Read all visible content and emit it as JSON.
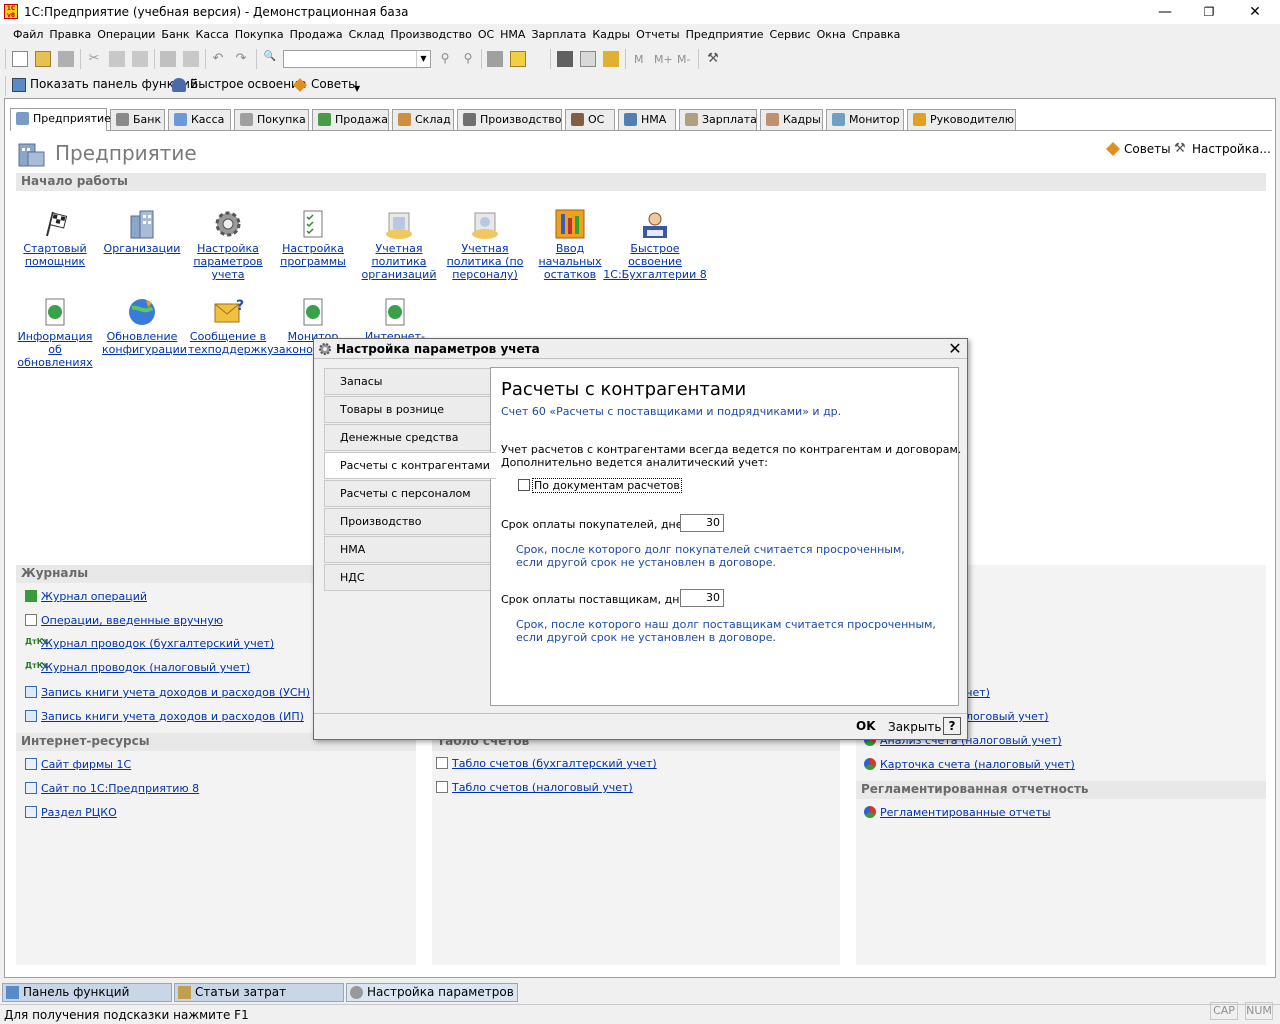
{
  "window": {
    "title": "1С:Предприятие (учебная версия) - Демонстрационная база",
    "app_icon_text": "1С v8"
  },
  "menu": [
    "Файл",
    "Правка",
    "Операции",
    "Банк",
    "Касса",
    "Покупка",
    "Продажа",
    "Склад",
    "Производство",
    "ОС",
    "НМА",
    "Зарплата",
    "Кадры",
    "Отчеты",
    "Предприятие",
    "Сервис",
    "Окна",
    "Справка"
  ],
  "toolbar2": {
    "show_panel": "Показать панель функций",
    "quick_learn": "Быстрое освоение",
    "tips": "Советы"
  },
  "toolbar_misc": {
    "m": "M",
    "mplus": "M+",
    "mminus": "M-"
  },
  "tabs": [
    "Предприятие",
    "Банк",
    "Касса",
    "Покупка",
    "Продажа",
    "Склад",
    "Производство",
    "ОС",
    "НМА",
    "Зарплата",
    "Кадры",
    "Монитор",
    "Руководителю"
  ],
  "page": {
    "title": "Предприятие",
    "tips_button": "Советы",
    "settings_button": "Настройка..."
  },
  "start_section": {
    "title": "Начало работы",
    "items_row1": [
      "Стартовый помощник",
      "Организации",
      "Настройка параметров учета",
      "Настройка программы",
      "Учетная политика организаций",
      "Учетная политика (по персоналу)",
      "Ввод начальных остатков",
      "Быстрое освоение 1С:Бухгалтерии 8"
    ],
    "items_row2": [
      "Информация об обновлениях",
      "Обновление конфигурации",
      "Сообщение в техподдержку",
      "Монитор законодательства",
      "Интернет-ресурс"
    ]
  },
  "journals": {
    "title": "Журналы",
    "links": [
      "Журнал операций",
      "Операции, введенные вручную",
      "Журнал проводок (бухгалтерский учет)",
      "Журнал проводок (налоговый учет)",
      "Запись книги учета доходов и расходов (УСН)",
      "Запись книги учета доходов и расходов (ИП)"
    ]
  },
  "internet": {
    "title": "Интернет-ресурсы",
    "links": [
      "Сайт фирмы 1С",
      "Сайт по 1С:Предприятию 8",
      "Раздел РЦКО"
    ]
  },
  "tablo": {
    "title": "Табло счетов",
    "links": [
      "Табло счетов (бухгалтерский учет)",
      "Табло счетов (налоговый учет)"
    ]
  },
  "right_col": {
    "partial1": "чет)",
    "partial2": "логовый учет)",
    "analysis": "Анализ счета (налоговый учет)",
    "card": "Карточка счета (налоговый учет)"
  },
  "reg": {
    "title": "Регламентированная отчетность",
    "links": [
      "Регламентированные отчеты"
    ]
  },
  "dialog": {
    "title": "Настройка параметров учета",
    "tabs": [
      "Запасы",
      "Товары в рознице",
      "Денежные средства",
      "Расчеты с контрагентами",
      "Расчеты с персоналом",
      "Производство",
      "НМА",
      "НДС"
    ],
    "heading": "Расчеты с контрагентами",
    "subheading": "Счет 60 «Расчеты с поставщиками и подрядчиками» и др.",
    "description_line1": "Учет расчетов с контрагентами всегда ведется по контрагентам и договорам.",
    "description_line2": "Дополнительно ведется аналитический учет:",
    "checkbox_label": "По документам расчетов",
    "buyers_label": "Срок оплаты покупателей, дней:",
    "buyers_value": "30",
    "buyers_hint1": "Срок, после которого долг покупателей считается просроченным,",
    "buyers_hint2": "если другой срок не установлен в договоре.",
    "suppliers_label": "Срок оплаты поставщикам, дней:",
    "suppliers_value": "30",
    "suppliers_hint1": "Срок, после которого наш долг поставщикам считается просроченным,",
    "suppliers_hint2": "если другой срок не установлен в договоре.",
    "ok": "OK",
    "close": "Закрыть",
    "help": "?"
  },
  "taskbar": [
    "Панель функций",
    "Статьи затрат",
    "Настройка параметров учета"
  ],
  "status": {
    "hint": "Для получения подсказки нажмите F1",
    "cap": "CAP",
    "num": "NUM"
  }
}
